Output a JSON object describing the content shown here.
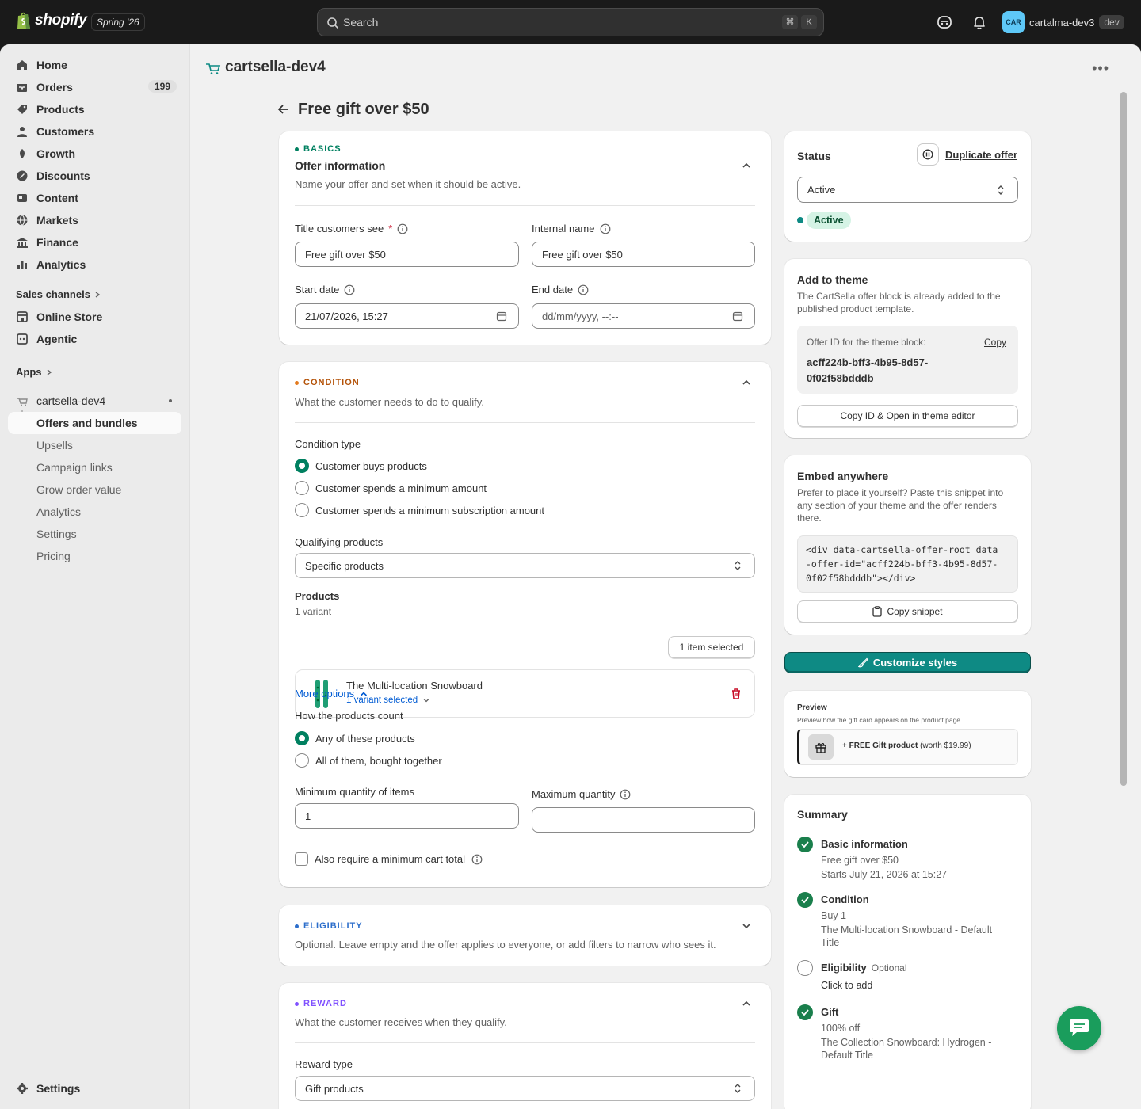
{
  "topbar": {
    "logo_text": "shopify",
    "edition": "Spring '26",
    "search_placeholder": "Search",
    "kbd_cmd": "⌘",
    "kbd_k": "K",
    "avatar_initials": "CAR",
    "account_name": "cartalma-dev3",
    "account_tag": "dev"
  },
  "sidebar": {
    "items": [
      {
        "label": "Home",
        "icon": "home-icon"
      },
      {
        "label": "Orders",
        "icon": "orders-icon",
        "badge": "199"
      },
      {
        "label": "Products",
        "icon": "tag-icon"
      },
      {
        "label": "Customers",
        "icon": "person-icon"
      },
      {
        "label": "Growth",
        "icon": "growth-icon"
      },
      {
        "label": "Discounts",
        "icon": "discount-icon"
      },
      {
        "label": "Content",
        "icon": "content-icon"
      },
      {
        "label": "Markets",
        "icon": "globe-icon"
      },
      {
        "label": "Finance",
        "icon": "bank-icon"
      },
      {
        "label": "Analytics",
        "icon": "bar-chart-icon"
      }
    ],
    "sales_channels_label": "Sales channels",
    "channels": [
      {
        "label": "Online Store",
        "icon": "store-icon"
      },
      {
        "label": "Agentic",
        "icon": "agent-icon"
      }
    ],
    "apps_label": "Apps",
    "app_name": "cartsella-dev4",
    "app_subitems": [
      "Offers and bundles",
      "Upsells",
      "Campaign links",
      "Grow order value",
      "Analytics",
      "Settings",
      "Pricing"
    ],
    "settings_label": "Settings"
  },
  "header": {
    "app_title": "cartsella-dev4",
    "more_label": "•••"
  },
  "page": {
    "title": "Free gift over $50"
  },
  "basics": {
    "kicker": "BASICS",
    "title": "Offer information",
    "description": "Name your offer and set when it should be active.",
    "title_label": "Title customers see",
    "title_value": "Free gift over $50",
    "internal_label": "Internal name",
    "internal_value": "Free gift over $50",
    "start_label": "Start date",
    "start_value": "21/07/2026, 15:27",
    "end_label": "End date",
    "end_placeholder": "dd/mm/yyyy, --:--"
  },
  "condition": {
    "kicker": "CONDITION",
    "description": "What the customer needs to do to qualify.",
    "type_label": "Condition type",
    "options": [
      "Customer buys products",
      "Customer spends a minimum amount",
      "Customer spends a minimum subscription amount"
    ],
    "qualifying_label": "Qualifying products",
    "qualifying_value": "Specific products",
    "products_label": "Products",
    "variant_count": "1 variant",
    "selected_button": "1 item selected",
    "product_name": "The Multi-location Snowboard",
    "variant_selected": "1 variant selected",
    "more_options": "More options",
    "count_label": "How the products count",
    "count_options": [
      "Any of these products",
      "All of them, bought together"
    ],
    "min_label": "Minimum quantity of items",
    "min_value": "1",
    "max_label": "Maximum quantity",
    "max_value": "",
    "also_require": "Also require a minimum cart total"
  },
  "eligibility": {
    "kicker": "ELIGIBILITY",
    "description": "Optional. Leave empty and the offer applies to everyone, or add filters to narrow who sees it."
  },
  "reward": {
    "kicker": "REWARD",
    "description": "What the customer receives when they qualify.",
    "type_label": "Reward type",
    "type_value": "Gift products"
  },
  "status": {
    "title": "Status",
    "duplicate": "Duplicate offer",
    "select_value": "Active",
    "badge": "Active"
  },
  "theme": {
    "title": "Add to theme",
    "text": "The CartSella offer block is already added to the published product template.",
    "id_label": "Offer ID for the theme block:",
    "copy": "Copy",
    "offer_id_line1": "acff224b-bff3-4b95-8d57-",
    "offer_id_line2": "0f02f58bdddb",
    "open_button": "Copy ID & Open in theme editor"
  },
  "embed": {
    "title": "Embed anywhere",
    "text": "Prefer to place it yourself? Paste this snippet into any section of your theme and the offer renders there.",
    "code_line1": "<div data-cartsella-offer-root data",
    "code_line2": "-offer-id=\"acff224b-bff3-4b95-8d57-",
    "code_line3": "0f02f58bdddb\"></div>",
    "copy_snippet": "Copy snippet"
  },
  "customize_button": "Customize styles",
  "preview": {
    "title": "Preview",
    "text": "Preview how the gift card appears on the product page.",
    "gift_bold": "+ FREE Gift product",
    "gift_rest": "(worth $19.99)"
  },
  "summary": {
    "title": "Summary",
    "basic_h": "Basic information",
    "basic_l1": "Free gift over $50",
    "basic_l2": "Starts July 21, 2026 at 15:27",
    "cond_h": "Condition",
    "cond_l1": "Buy 1",
    "cond_l2": "The Multi-location Snowboard - Default Title",
    "elig_h": "Eligibility",
    "elig_opt": "Optional",
    "elig_l1": "Click to add",
    "gift_h": "Gift",
    "gift_l1": "100% off",
    "gift_l2": "The Collection Snowboard: Hydrogen - Default Title"
  },
  "colors": {
    "basics": "#008060",
    "condition": "#b45309",
    "eligibility": "#2c6ecb",
    "reward": "#8051ff",
    "primary": "#0e8a84"
  }
}
